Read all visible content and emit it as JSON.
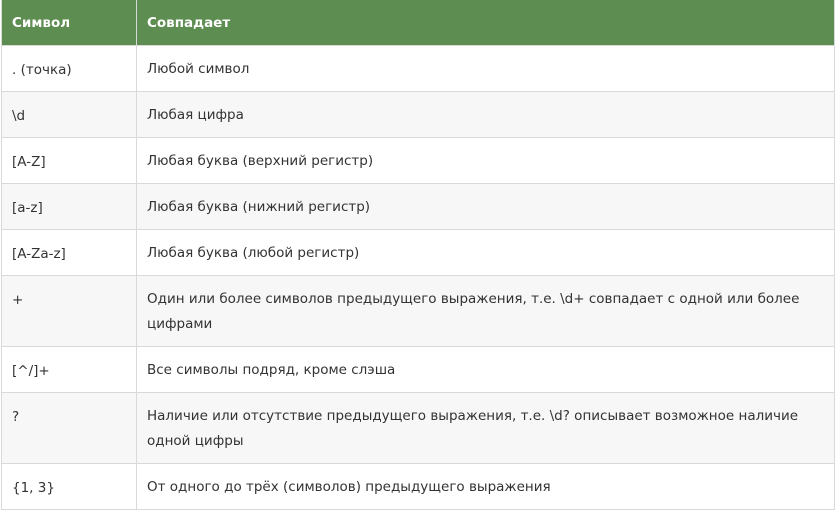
{
  "table": {
    "headers": [
      "Символ",
      "Совпадает"
    ],
    "rows": [
      [
        ". (точка)",
        "Любой символ"
      ],
      [
        "\\d",
        "Любая цифра"
      ],
      [
        "[A-Z]",
        "Любая буква (верхний регистр)"
      ],
      [
        "[a-z]",
        "Любая буква (нижний регистр)"
      ],
      [
        "[A-Za-z]",
        "Любая буква (любой регистр)"
      ],
      [
        "+",
        "Один или более символов предыдущего выражения, т.е. \\d+ совпадает с одной или более цифрами"
      ],
      [
        "[^/]+",
        "Все символы подряд, кроме слэша"
      ],
      [
        "?",
        "Наличие или отсутствие предыдущего выражения, т.е. \\d? описывает возможное наличие одной цифры"
      ],
      [
        "{1, 3}",
        "От одного до трёх (символов) предыдущего выражения"
      ]
    ]
  },
  "colors": {
    "header_bg": "#5e8d51",
    "header_text": "#ffffff",
    "row_alt_bg": "#f7f7f7",
    "border": "#d9d9d9",
    "text": "#333333"
  }
}
